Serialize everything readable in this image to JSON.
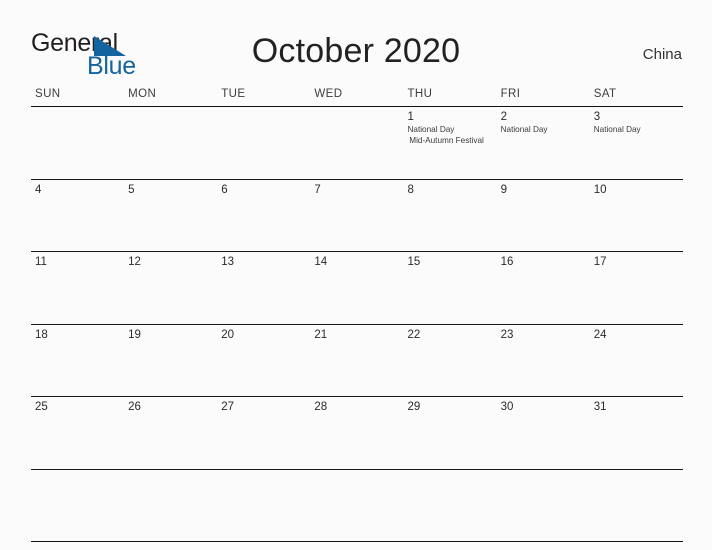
{
  "brand": {
    "name_part1": "General",
    "name_part2": "Blue",
    "accent_color": "#14659f"
  },
  "header": {
    "title": "October 2020",
    "country": "China"
  },
  "calendar": {
    "day_headers": [
      "SUN",
      "MON",
      "TUE",
      "WED",
      "THU",
      "FRI",
      "SAT"
    ],
    "weeks": [
      [
        {
          "day": "",
          "events": []
        },
        {
          "day": "",
          "events": []
        },
        {
          "day": "",
          "events": []
        },
        {
          "day": "",
          "events": []
        },
        {
          "day": "1",
          "events": [
            "National Day",
            "Mid-Autumn Festival"
          ]
        },
        {
          "day": "2",
          "events": [
            "National Day"
          ]
        },
        {
          "day": "3",
          "events": [
            "National Day"
          ]
        }
      ],
      [
        {
          "day": "4",
          "events": []
        },
        {
          "day": "5",
          "events": []
        },
        {
          "day": "6",
          "events": []
        },
        {
          "day": "7",
          "events": []
        },
        {
          "day": "8",
          "events": []
        },
        {
          "day": "9",
          "events": []
        },
        {
          "day": "10",
          "events": []
        }
      ],
      [
        {
          "day": "11",
          "events": []
        },
        {
          "day": "12",
          "events": []
        },
        {
          "day": "13",
          "events": []
        },
        {
          "day": "14",
          "events": []
        },
        {
          "day": "15",
          "events": []
        },
        {
          "day": "16",
          "events": []
        },
        {
          "day": "17",
          "events": []
        }
      ],
      [
        {
          "day": "18",
          "events": []
        },
        {
          "day": "19",
          "events": []
        },
        {
          "day": "20",
          "events": []
        },
        {
          "day": "21",
          "events": []
        },
        {
          "day": "22",
          "events": []
        },
        {
          "day": "23",
          "events": []
        },
        {
          "day": "24",
          "events": []
        }
      ],
      [
        {
          "day": "25",
          "events": []
        },
        {
          "day": "26",
          "events": []
        },
        {
          "day": "27",
          "events": []
        },
        {
          "day": "28",
          "events": []
        },
        {
          "day": "29",
          "events": []
        },
        {
          "day": "30",
          "events": []
        },
        {
          "day": "31",
          "events": []
        }
      ]
    ]
  }
}
